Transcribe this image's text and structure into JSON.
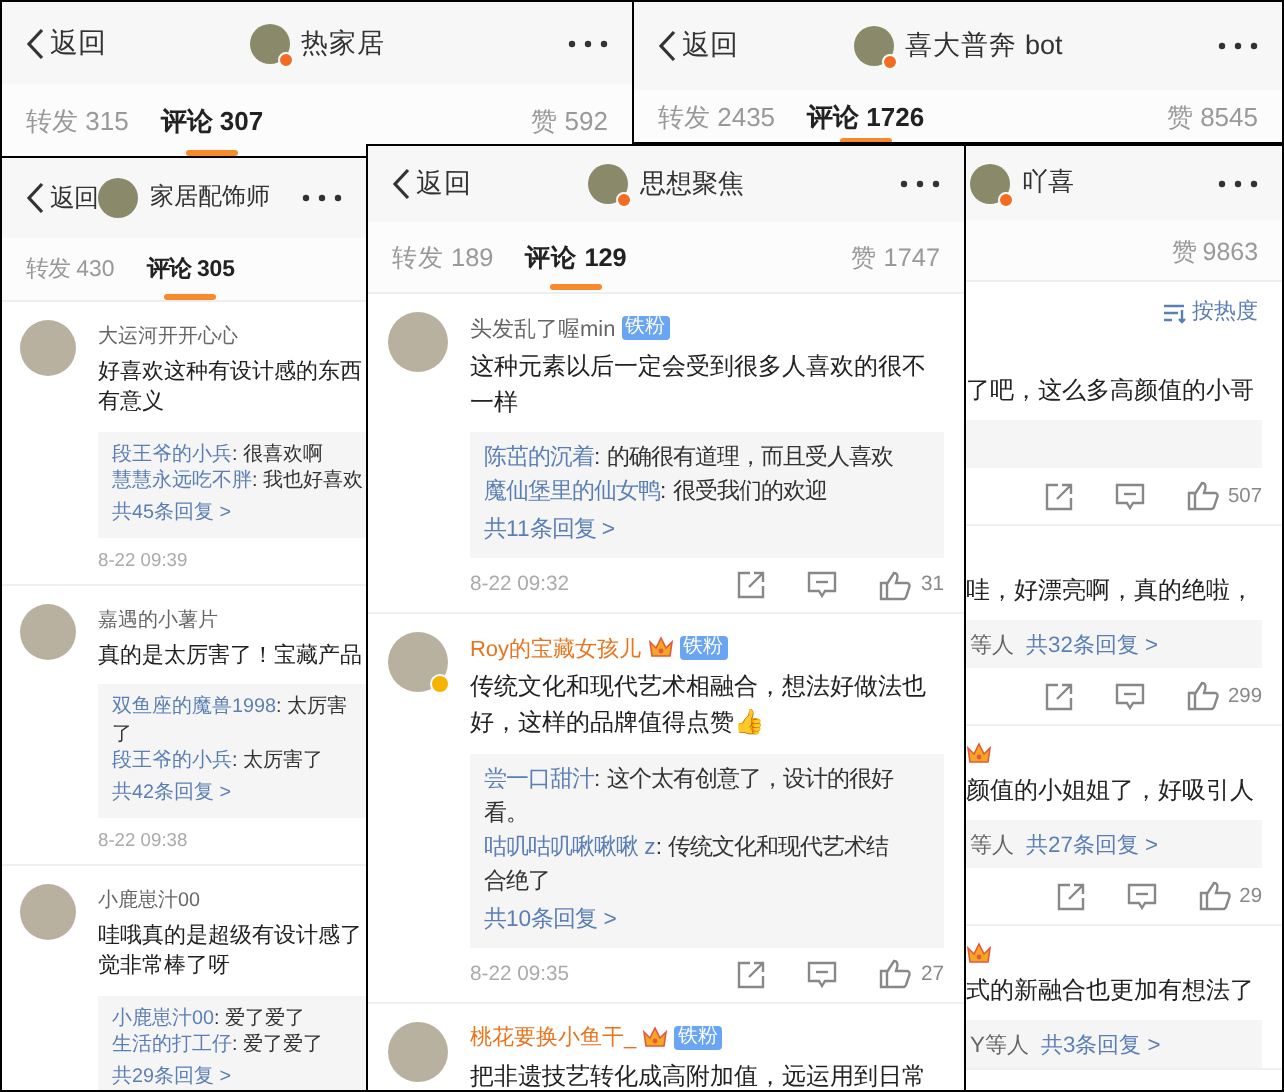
{
  "panels": [
    {
      "kind": "post",
      "back": "返回",
      "title": "热家居",
      "verified": true,
      "tabs": [
        {
          "label": "转发 315",
          "selected": false
        },
        {
          "label": "评论 307",
          "selected": true
        }
      ],
      "likes_tab": {
        "label": "赞 592",
        "selected": false
      }
    },
    {
      "kind": "post",
      "back": "返回",
      "title": "喜大普奔 bot",
      "verified": true,
      "tabs": [
        {
          "label": "转发 2435",
          "selected": false
        },
        {
          "label": "评论 1726",
          "selected": true
        }
      ],
      "likes_tab": {
        "label": "赞 8545",
        "selected": false
      }
    },
    {
      "kind": "post",
      "back": "返回",
      "title": "家居配饰师",
      "verified": false,
      "tabs": [
        {
          "label": "转发 430",
          "selected": false
        },
        {
          "label": "评论 305",
          "selected": true
        }
      ],
      "comments": [
        {
          "user": "大运河开开心心",
          "vip": false,
          "verified": false,
          "text": "好喜欢这种有设计感的东西有意义",
          "replies": [
            {
              "user": "段王爷的小兵",
              "text": ": 很喜欢啊"
            },
            {
              "user": "慧慧永远吃不胖",
              "text": ": 我也好喜欢"
            }
          ],
          "more": "共45条回复 >",
          "time": "8-22 09:39"
        },
        {
          "user": "嘉遇的小薯片",
          "vip": false,
          "verified": false,
          "text": "真的是太厉害了！宝藏产品",
          "replies": [
            {
              "user": "双鱼座的魔兽1998",
              "text": ": 太厉害了"
            },
            {
              "user": "段王爷的小兵",
              "text": ": 太厉害了"
            }
          ],
          "more": "共42条回复 >",
          "time": "8-22 09:38"
        },
        {
          "user": "小鹿崽汁00",
          "vip": false,
          "verified": false,
          "text": "哇哦真的是超级有设计感了觉非常棒了呀",
          "replies": [
            {
              "user": "小鹿崽汁00",
              "text": ": 爱了爱了"
            },
            {
              "user": "生活的打工仔",
              "text": ": 爱了爱了"
            }
          ],
          "more": "共29条回复 >"
        }
      ]
    },
    {
      "kind": "post",
      "back": "返回",
      "title": "思想聚焦",
      "verified": true,
      "tabs": [
        {
          "label": "转发 189",
          "selected": false
        },
        {
          "label": "评论 129",
          "selected": true
        }
      ],
      "likes_tab": {
        "label": "赞 1747",
        "selected": false
      },
      "comments": [
        {
          "user": "头发乱了喔min",
          "vip": false,
          "fan": "铁粉",
          "verified": false,
          "text": "这种元素以后一定会受到很多人喜欢的很不一样",
          "replies": [
            {
              "user": "陈茁的沉着",
              "text": ": 的确很有道理，而且受人喜欢"
            },
            {
              "user": "魔仙堡里的仙女鸭",
              "text": ": 很受我们的欢迎"
            }
          ],
          "more": "共11条回复 >",
          "time": "8-22 09:32",
          "likes": "31"
        },
        {
          "user": "Roy的宝藏女孩儿",
          "vip": true,
          "fan": "铁粉",
          "verified": true,
          "text": "传统文化和现代艺术相融合，想法好做法也好，这样的品牌值得点赞👍",
          "replies": [
            {
              "user": "尝一口甜汁",
              "text": ": 这个太有创意了，设计的很好看。"
            },
            {
              "user": "咕叽咕叽啾啾啾 z",
              "text": ": 传统文化和现代艺术结合绝了"
            }
          ],
          "more": "共10条回复 >",
          "time": "8-22 09:35",
          "likes": "27"
        },
        {
          "user": "桃花要换小鱼干_",
          "vip": true,
          "fan": "铁粉",
          "verified": false,
          "text": "把非遗技艺转化成高附加值，远运用到日常"
        }
      ]
    },
    {
      "kind": "cropped",
      "title": "吖喜",
      "verified": true,
      "likes_tab": {
        "label": "赞 9863",
        "selected": false
      },
      "sort": "按热度",
      "comments": [
        {
          "vip": false,
          "text": "了吧，这么多高颜值的小哥",
          "likes": "507"
        },
        {
          "vip": false,
          "text": "哇，好漂亮啊，真的绝啦，",
          "who": "等人",
          "more": "共32条回复 >",
          "likes": "299"
        },
        {
          "vip": true,
          "text": "颜值的小姐姐了，好吸引人",
          "who": "等人",
          "more": "共27条回复 >",
          "likes": "29"
        },
        {
          "vip": true,
          "text": "式的新融合也更加有想法了",
          "who": "Y等人",
          "more": "共3条回复 >"
        }
      ]
    }
  ]
}
